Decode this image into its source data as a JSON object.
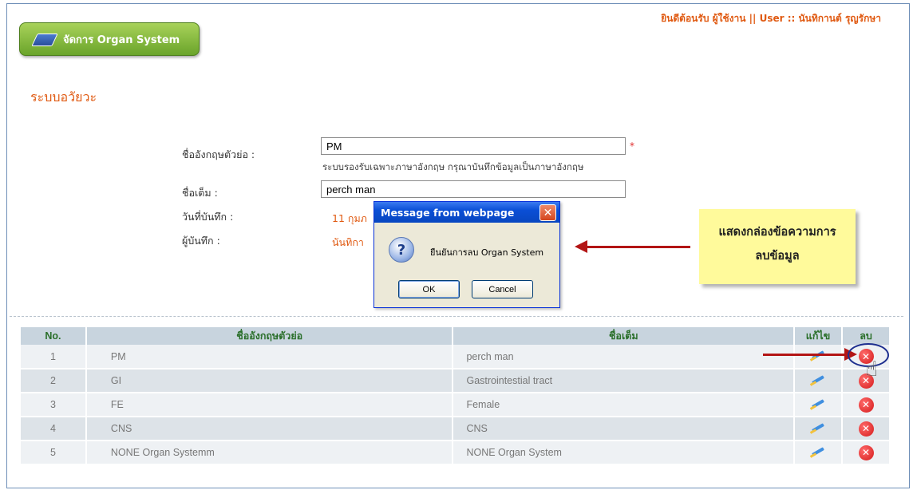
{
  "header": {
    "welcome": "ยินดีต้อนรับ ผู้ใช้งาน || User :: นันทิกานต์ รุญรักษา",
    "page_button_label": "จัดการ Organ System"
  },
  "section_title": "ระบบอวัยวะ",
  "form": {
    "abbr_label": "ชื่ออังกฤษตัวย่อ :",
    "abbr_value": "PM",
    "required_mark": "*",
    "hint": "ระบบรองรับเฉพาะภาษาอังกฤษ กรุณาบันทึกข้อมูลเป็นภาษาอังกฤษ",
    "fullname_label": "ชื่อเต็ม :",
    "fullname_value": "perch man",
    "date_label": "วันที่บันทึก :",
    "date_value": "11 กุมภ",
    "recorder_label": "ผู้บันทึก :",
    "recorder_value": "นันทิกา"
  },
  "table": {
    "headers": [
      "No.",
      "ชื่ออังกฤษตัวย่อ",
      "ชื่อเต็ม",
      "แก้ไข",
      "ลบ"
    ],
    "rows": [
      {
        "no": "1",
        "abbr": "PM",
        "full": "perch man"
      },
      {
        "no": "2",
        "abbr": "GI",
        "full": "Gastrointestial tract"
      },
      {
        "no": "3",
        "abbr": "FE",
        "full": "Female"
      },
      {
        "no": "4",
        "abbr": "CNS",
        "full": "CNS"
      },
      {
        "no": "5",
        "abbr": "NONE Organ Systemm",
        "full": "NONE Organ System"
      }
    ]
  },
  "dialog": {
    "title": "Message from webpage",
    "close": "✕",
    "icon_glyph": "?",
    "message": "ยืนยันการลบ Organ System",
    "ok": "OK",
    "cancel": "Cancel"
  },
  "callout": {
    "line1": "แสดงกล่องข้อความการ",
    "line2": "ลบข้อมูล"
  },
  "colors": {
    "accent_orange": "#e05a12",
    "header_green": "#2a6f2a",
    "arrow_red": "#b31515"
  }
}
